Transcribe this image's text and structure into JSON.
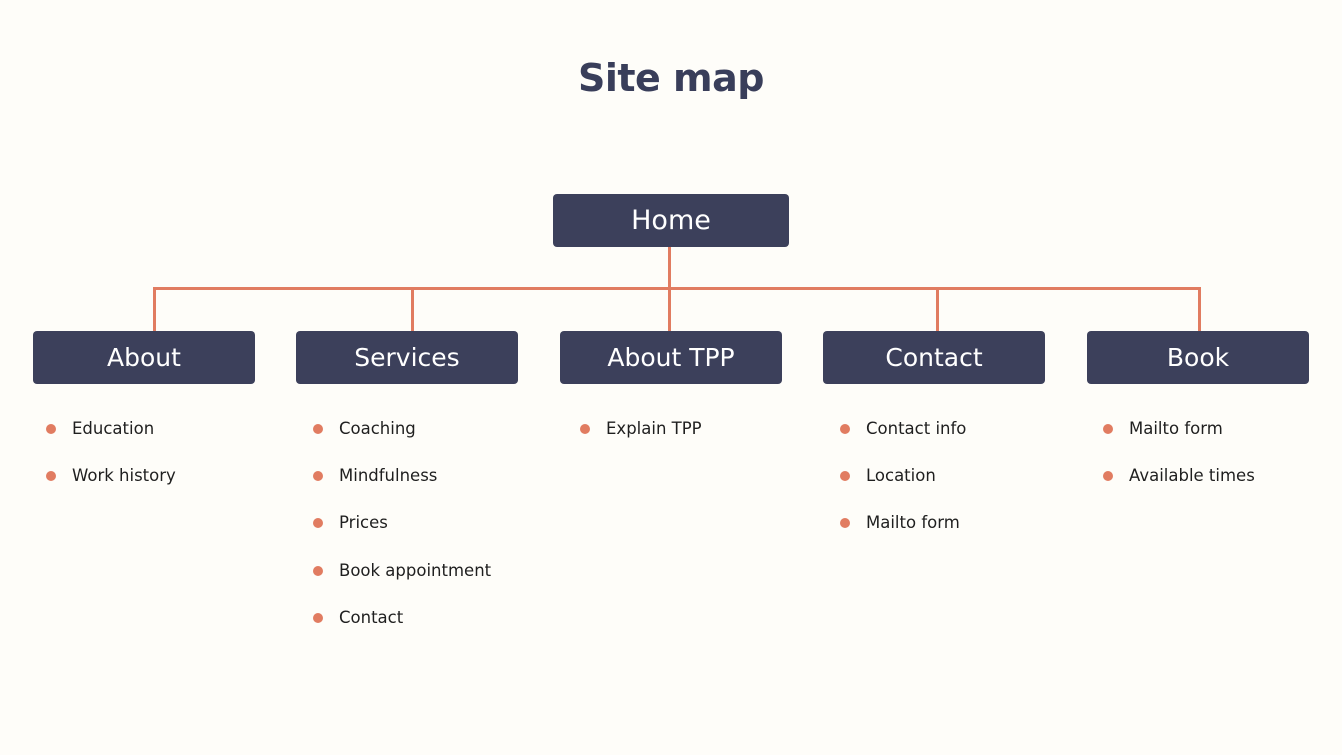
{
  "title": "Site map",
  "colors": {
    "node_bg": "#3c405b",
    "node_text": "#ffffff",
    "connector": "#e17c61",
    "bullet": "#e17c61",
    "title": "#393e5a",
    "background": "#fefdf9"
  },
  "root": {
    "label": "Home"
  },
  "sections": [
    {
      "label": "About",
      "items": [
        "Education",
        "Work history"
      ]
    },
    {
      "label": "Services",
      "items": [
        "Coaching",
        "Mindfulness",
        "Prices",
        "Book appointment",
        "Contact"
      ]
    },
    {
      "label": "About TPP",
      "items": [
        "Explain TPP"
      ]
    },
    {
      "label": "Contact",
      "items": [
        "Contact info",
        "Location",
        "Mailto form"
      ]
    },
    {
      "label": "Book",
      "items": [
        "Mailto form",
        "Available times"
      ]
    }
  ]
}
